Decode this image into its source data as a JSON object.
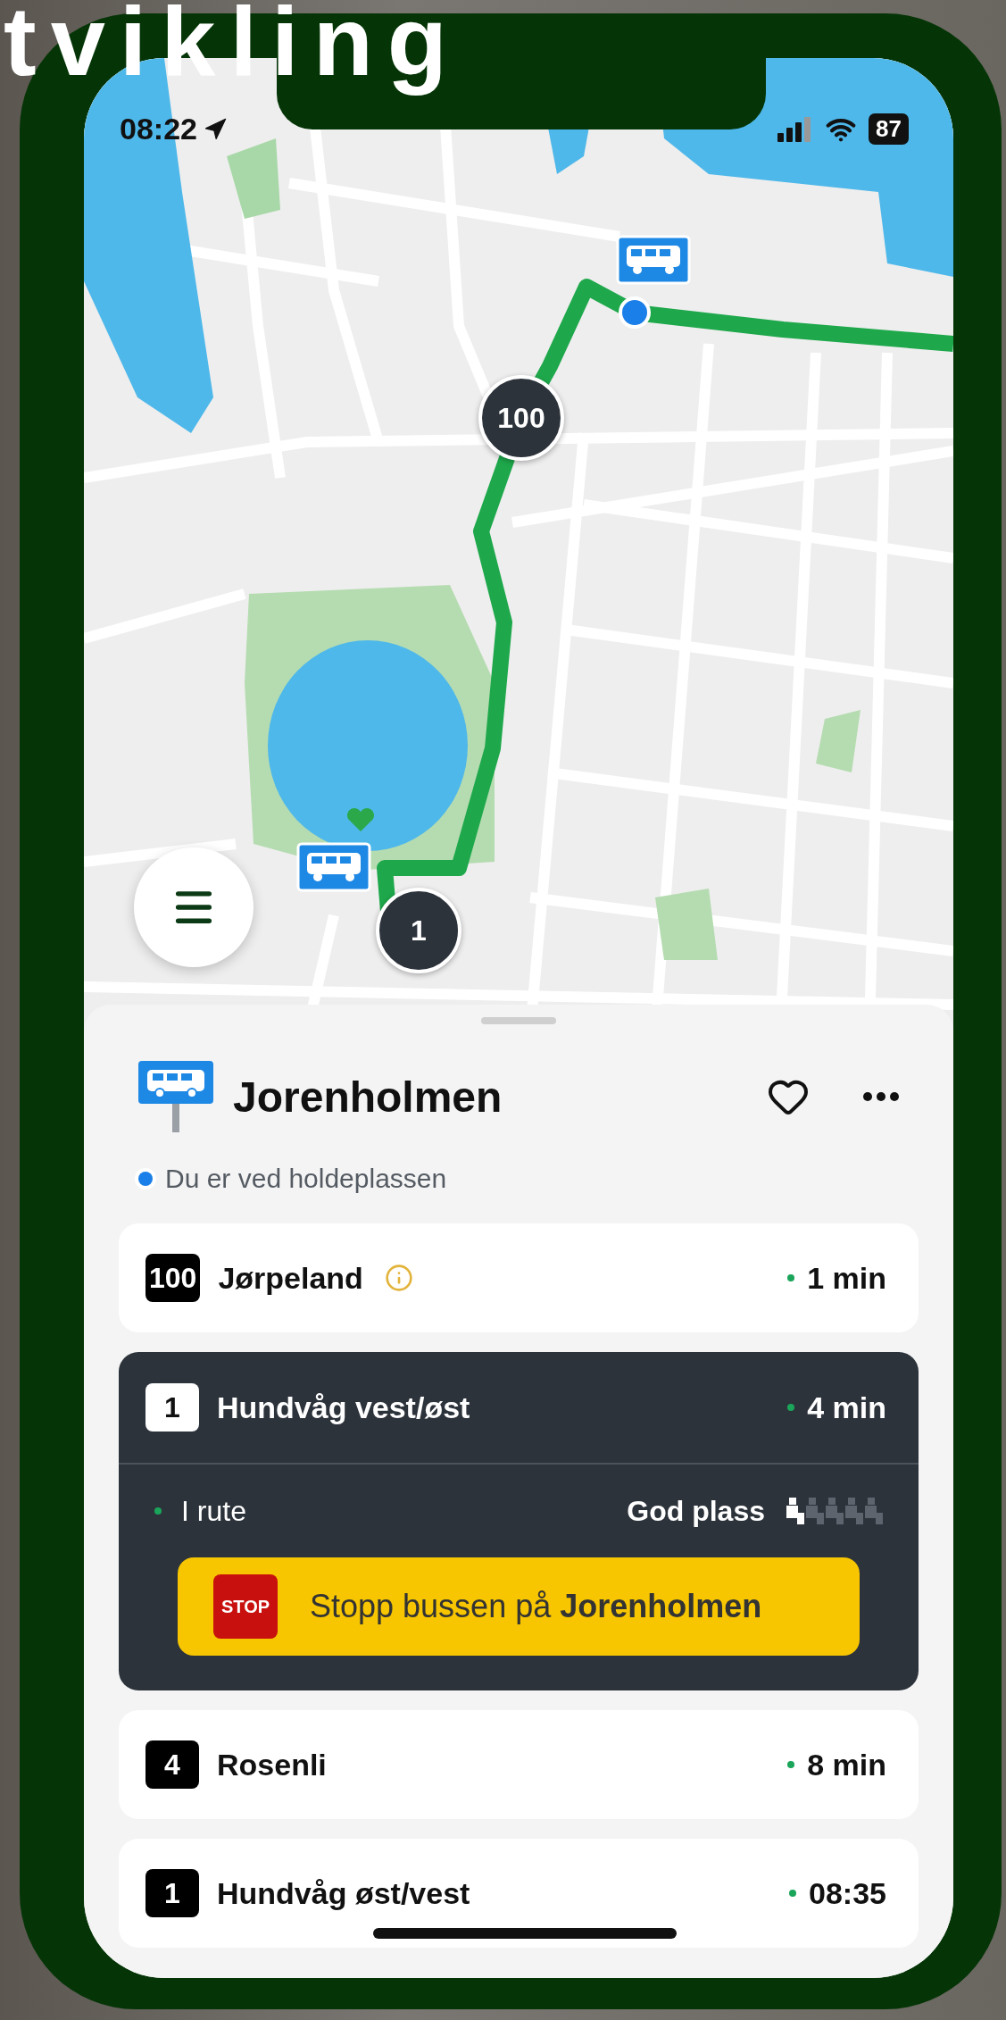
{
  "headline": "tvikling",
  "status_bar": {
    "time": "08:22",
    "battery": "87"
  },
  "map": {
    "markers": [
      {
        "label": "100"
      },
      {
        "label": "1"
      }
    ]
  },
  "stop": {
    "name": "Jorenholmen",
    "favorite": false,
    "location_note": "Du er ved holdeplassen"
  },
  "departures": [
    {
      "line": "100",
      "destination": "Jørpeland",
      "info": true,
      "time": "1 min",
      "expanded": false
    },
    {
      "line": "1",
      "destination": "Hundvåg vest/øst",
      "info": false,
      "time": "4 min",
      "expanded": true,
      "status": "I rute",
      "occupancy": "God plass",
      "stars": 1,
      "stop_sign": "STOP",
      "stop_button": "Stopp bussen på **Jorenholmen**"
    },
    {
      "line": "4",
      "destination": "Rosenli",
      "info": false,
      "time": "8 min",
      "expanded": false
    },
    {
      "line": "1",
      "destination": "Hundvåg øst/vest",
      "info": false,
      "time": "08:35",
      "expanded": false
    }
  ]
}
